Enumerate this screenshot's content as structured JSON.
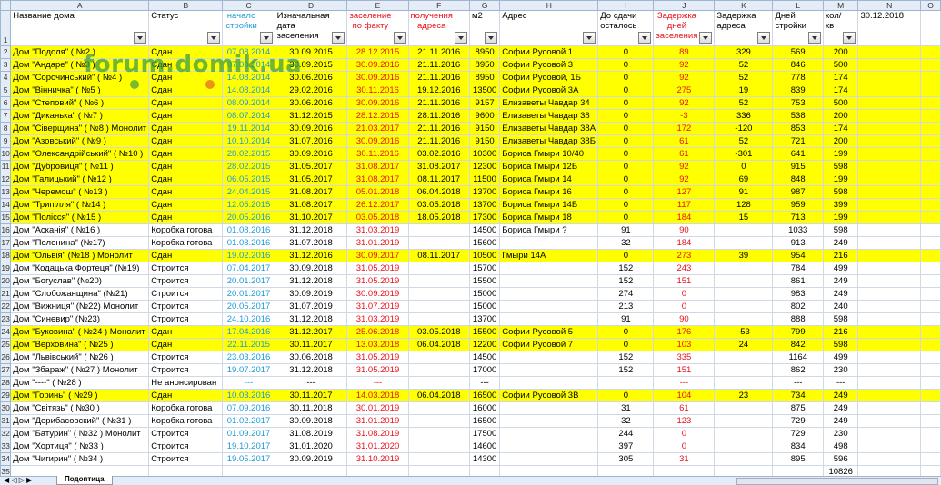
{
  "columns": [
    "A",
    "B",
    "C",
    "D",
    "E",
    "F",
    "G",
    "H",
    "I",
    "J",
    "K",
    "L",
    "M",
    "N",
    "O"
  ],
  "header": {
    "row": "1",
    "cells": [
      {
        "text": "Название дома",
        "cls": "",
        "filter": true
      },
      {
        "text": "Статус",
        "cls": "",
        "filter": true
      },
      {
        "text": "начало стройки",
        "cls": "c blue",
        "filter": true
      },
      {
        "text": "Изначальная дата заселения",
        "cls": "",
        "filter": true
      },
      {
        "text": "заселение по факту",
        "cls": "c red",
        "filter": true
      },
      {
        "text": "получения адреса",
        "cls": "c red",
        "filter": true
      },
      {
        "text": "м2",
        "cls": "",
        "filter": true
      },
      {
        "text": "Адрес",
        "cls": "",
        "filter": true
      },
      {
        "text": "До сдачи осталось",
        "cls": "",
        "filter": true
      },
      {
        "text": "Задержка дней заселения",
        "cls": "c red",
        "filter": true
      },
      {
        "text": "Задержка адреса",
        "cls": "",
        "filter": true
      },
      {
        "text": "Дней стройки",
        "cls": "",
        "filter": true
      },
      {
        "text": "кол/кв",
        "cls": "",
        "filter": true
      },
      {
        "text": "30.12.2018",
        "cls": "c",
        "filter": false
      },
      {
        "text": "",
        "cls": "",
        "filter": false
      }
    ]
  },
  "rows": [
    {
      "n": "2",
      "y": true,
      "c": [
        "Дом \"Подоля\" ( №2 )",
        "Сдан",
        "07.08.2014",
        "30.09.2015",
        "28.12.2015",
        "21.11.2016",
        "8950",
        "Софии Русовой 1",
        "0",
        "89",
        "329",
        "569",
        "200",
        "",
        ""
      ]
    },
    {
      "n": "3",
      "y": true,
      "c": [
        "Дом \"Андаре\" ( №3 )",
        "Сдан",
        "07.08.2014",
        "30.09.2015",
        "30.09.2016",
        "21.11.2016",
        "8950",
        "Софии Русовой 3",
        "0",
        "92",
        "52",
        "846",
        "500",
        "",
        ""
      ]
    },
    {
      "n": "4",
      "y": true,
      "c": [
        "Дом \"Сорочинський\" ( №4 )",
        "Сдан",
        "14.08.2014",
        "30.06.2016",
        "30.09.2016",
        "21.11.2016",
        "8950",
        "Софии Русовой, 1Б",
        "0",
        "92",
        "52",
        "778",
        "174",
        "",
        ""
      ]
    },
    {
      "n": "5",
      "y": true,
      "c": [
        "Дом \"Вінничка\" ( №5 )",
        "Сдан",
        "14.08.2014",
        "29.02.2016",
        "30.11.2016",
        "19.12.2016",
        "13500",
        "Софии Русовой 3А",
        "0",
        "275",
        "19",
        "839",
        "174",
        "",
        ""
      ]
    },
    {
      "n": "6",
      "y": true,
      "c": [
        "Дом \"Степовий\" ( №6 )",
        "Сдан",
        "08.09.2014",
        "30.06.2016",
        "30.09.2016",
        "21.11.2016",
        "9157",
        "Елизаветы Чавдар 34",
        "0",
        "92",
        "52",
        "753",
        "500",
        "",
        ""
      ]
    },
    {
      "n": "7",
      "y": true,
      "c": [
        "Дом \"Диканька\" ( №7 )",
        "Сдан",
        "08.07.2014",
        "31.12.2015",
        "28.12.2015",
        "28.11.2016",
        "9600",
        "Елизаветы Чавдар 38",
        "0",
        "-3",
        "336",
        "538",
        "200",
        "",
        ""
      ]
    },
    {
      "n": "8",
      "y": true,
      "c": [
        "Дом \"Сіверщина\" ( №8 ) Монолит",
        "Сдан",
        "19.11.2014",
        "30.09.2016",
        "21.03.2017",
        "21.11.2016",
        "9150",
        "Елизаветы Чавдар 38А",
        "0",
        "172",
        "-120",
        "853",
        "174",
        "",
        ""
      ]
    },
    {
      "n": "9",
      "y": true,
      "c": [
        "Дом \"Азовський\" ( №9 )",
        "Сдан",
        "10.10.2014",
        "31.07.2016",
        "30.09.2016",
        "21.11.2016",
        "9150",
        "Елизаветы Чавдар 38Б",
        "0",
        "61",
        "52",
        "721",
        "200",
        "",
        ""
      ]
    },
    {
      "n": "10",
      "y": true,
      "c": [
        "Дом \"Олександрійський\" ( №10 )",
        "Сдан",
        "28.02.2015",
        "30.09.2016",
        "30.11.2016",
        "03.02.2016",
        "10300",
        "Бориса Гмыри 10/40",
        "0",
        "61",
        "-301",
        "641",
        "199",
        "",
        ""
      ]
    },
    {
      "n": "11",
      "y": true,
      "c": [
        "Дом \"Дубровиця\" ( №11 )",
        "Сдан",
        "28.02.2015",
        "31.05.2017",
        "31.08.2017",
        "31.08.2017",
        "12300",
        "Бориса Гмыри 12Б",
        "0",
        "92",
        "0",
        "915",
        "598",
        "",
        ""
      ]
    },
    {
      "n": "12",
      "y": true,
      "c": [
        "Дом \"Галицький\" ( №12 )",
        "Сдан",
        "06.05.2015",
        "31.05.2017",
        "31.08.2017",
        "08.11.2017",
        "11500",
        "Бориса Гмыри 14",
        "0",
        "92",
        "69",
        "848",
        "199",
        "",
        ""
      ]
    },
    {
      "n": "13",
      "y": true,
      "c": [
        "Дом \"Черемош\" ( №13 )",
        "Сдан",
        "24.04.2015",
        "31.08.2017",
        "05.01.2018",
        "06.04.2018",
        "13700",
        "Бориса Гмыри 16",
        "0",
        "127",
        "91",
        "987",
        "598",
        "",
        ""
      ]
    },
    {
      "n": "14",
      "y": true,
      "c": [
        "Дом \"Трипілля\" ( №14 )",
        "Сдан",
        "12.05.2015",
        "31.08.2017",
        "26.12.2017",
        "03.05.2018",
        "13700",
        "Бориса Гмыри 14Б",
        "0",
        "117",
        "128",
        "959",
        "399",
        "",
        ""
      ]
    },
    {
      "n": "15",
      "y": true,
      "c": [
        "Дом \"Полісся\" ( №15 )",
        "Сдан",
        "20.05.2016",
        "31.10.2017",
        "03.05.2018",
        "18.05.2018",
        "17300",
        "Бориса Гмыри 18",
        "0",
        "184",
        "15",
        "713",
        "199",
        "",
        ""
      ]
    },
    {
      "n": "16",
      "y": false,
      "c": [
        "Дом \"Асканія\" ( №16 )",
        "Коробка готова",
        "01.08.2016",
        "31.12.2018",
        "31.03.2019",
        "",
        "14500",
        "Бориса Гмыри ?",
        "91",
        "90",
        "",
        "1033",
        "598",
        "",
        ""
      ]
    },
    {
      "n": "17",
      "y": false,
      "c": [
        "Дом \"Полонина\" (№17)",
        "Коробка готова",
        "01.08.2016",
        "31.07.2018",
        "31.01.2019",
        "",
        "15600",
        "",
        "32",
        "184",
        "",
        "913",
        "249",
        "",
        ""
      ]
    },
    {
      "n": "18",
      "y": true,
      "c": [
        "Дом \"Ольвія\" (№18 ) Монолит",
        "Сдан",
        "19.02.2016",
        "31.12.2016",
        "30.09.2017",
        "08.11.2017",
        "10500",
        "Гмыри 14А",
        "0",
        "273",
        "39",
        "954",
        "216",
        "",
        ""
      ]
    },
    {
      "n": "19",
      "y": false,
      "c": [
        "Дом \"Кодацька Фортеця\" (№19)",
        "Строится",
        "07.04.2017",
        "30.09.2018",
        "31.05.2019",
        "",
        "15700",
        "",
        "152",
        "243",
        "",
        "784",
        "499",
        "",
        ""
      ]
    },
    {
      "n": "20",
      "y": false,
      "c": [
        "Дом \"Богуслав\" (№20)",
        "Строится",
        "20.01.2017",
        "31.12.2018",
        "31.05.2019",
        "",
        "15500",
        "",
        "152",
        "151",
        "",
        "861",
        "249",
        "",
        ""
      ]
    },
    {
      "n": "21",
      "y": false,
      "c": [
        "Дом \"Слобожанщина\" (№21)",
        "Строится",
        "20.01.2017",
        "30.09.2019",
        "30.09.2019",
        "",
        "15000",
        "",
        "274",
        "0",
        "",
        "983",
        "249",
        "",
        ""
      ]
    },
    {
      "n": "22",
      "y": false,
      "c": [
        "Дом \"Вижниця\" (№22) Монолит",
        "Строится",
        "20.05.2017",
        "31.07.2019",
        "31.07.2019",
        "",
        "15000",
        "",
        "213",
        "0",
        "",
        "802",
        "240",
        "",
        ""
      ]
    },
    {
      "n": "23",
      "y": false,
      "c": [
        "Дом \"Синевир\" (№23)",
        "Строится",
        "24.10.2016",
        "31.12.2018",
        "31.03.2019",
        "",
        "13700",
        "",
        "91",
        "90",
        "",
        "888",
        "598",
        "",
        ""
      ]
    },
    {
      "n": "24",
      "y": true,
      "c": [
        "Дом \"Буковина\" ( №24 ) Монолит",
        "Сдан",
        "17.04.2016",
        "31.12.2017",
        "25.06.2018",
        "03.05.2018",
        "15500",
        "Софии Русовой 5",
        "0",
        "176",
        "-53",
        "799",
        "216",
        "",
        ""
      ]
    },
    {
      "n": "25",
      "y": true,
      "c": [
        "Дом \"Верховина\" ( №25 )",
        "Сдан",
        "22.11.2015",
        "30.11.2017",
        "13.03.2018",
        "06.04.2018",
        "12200",
        "Софии Русовой 7",
        "0",
        "103",
        "24",
        "842",
        "598",
        "",
        ""
      ]
    },
    {
      "n": "26",
      "y": false,
      "c": [
        "Дом \"Львівський\" ( №26 )",
        "Строится",
        "23.03.2016",
        "30.06.2018",
        "31.05.2019",
        "",
        "14500",
        "",
        "152",
        "335",
        "",
        "1164",
        "499",
        "",
        ""
      ]
    },
    {
      "n": "27",
      "y": false,
      "c": [
        "Дом \"Збараж\" ( №27 ) Монолит",
        "Строится",
        "19.07.2017",
        "31.12.2018",
        "31.05.2019",
        "",
        "17000",
        "",
        "152",
        "151",
        "",
        "862",
        "230",
        "",
        ""
      ]
    },
    {
      "n": "28",
      "y": false,
      "c": [
        "Дом \"----\" ( №28 )",
        "Не анонсирован",
        "---",
        "---",
        "---",
        "",
        "---",
        "",
        "",
        "---",
        "",
        "---",
        "---",
        "",
        ""
      ]
    },
    {
      "n": "29",
      "y": true,
      "c": [
        "Дом \"Горинь\" ( №29 )",
        "Сдан",
        "10.03.2016",
        "30.11.2017",
        "14.03.2018",
        "06.04.2018",
        "16500",
        "Софии Русовой 3В",
        "0",
        "104",
        "23",
        "734",
        "249",
        "",
        ""
      ]
    },
    {
      "n": "30",
      "y": false,
      "c": [
        "Дом \"Світязь\" ( №30 )",
        "Коробка готова",
        "07.09.2016",
        "30.11.2018",
        "30.01.2019",
        "",
        "16000",
        "",
        "31",
        "61",
        "",
        "875",
        "249",
        "",
        ""
      ]
    },
    {
      "n": "31",
      "y": false,
      "c": [
        "Дом \"Дерибасовский\" ( №31 )",
        "Коробка готова",
        "01.02.2017",
        "30.09.2018",
        "31.01.2019",
        "",
        "16500",
        "",
        "32",
        "123",
        "",
        "729",
        "249",
        "",
        ""
      ]
    },
    {
      "n": "32",
      "y": false,
      "c": [
        "Дом \"Батурин\" ( №32 ) Монолит",
        "Строится",
        "01.09.2017",
        "31.08.2019",
        "31.08.2019",
        "",
        "17500",
        "",
        "244",
        "0",
        "",
        "729",
        "230",
        "",
        ""
      ]
    },
    {
      "n": "33",
      "y": false,
      "c": [
        "Дом \"Хортиця\" ( №33 )",
        "Строится",
        "19.10.2017",
        "31.01.2020",
        "31.01.2020",
        "",
        "14600",
        "",
        "397",
        "0",
        "",
        "834",
        "498",
        "",
        ""
      ]
    },
    {
      "n": "34",
      "y": false,
      "c": [
        "Дом \"Чигирин\" ( №34 )",
        "Строится",
        "19.05.2017",
        "30.09.2019",
        "31.10.2019",
        "",
        "14300",
        "",
        "305",
        "31",
        "",
        "895",
        "596",
        "",
        ""
      ]
    },
    {
      "n": "35",
      "y": false,
      "c": [
        "",
        "",
        "",
        "",
        "",
        "",
        "",
        "",
        "",
        "",
        "",
        "",
        "10826",
        "",
        ""
      ]
    }
  ],
  "watermark": "forum.domik.ua",
  "sheet_tab": "Подоптица",
  "colors": {
    "yellow": "#ffff00",
    "blue_text": "#1f9bd7",
    "red_text": "#e8131b",
    "header_bg": "#e4ecf7",
    "selected_header": "#f9d99f"
  }
}
